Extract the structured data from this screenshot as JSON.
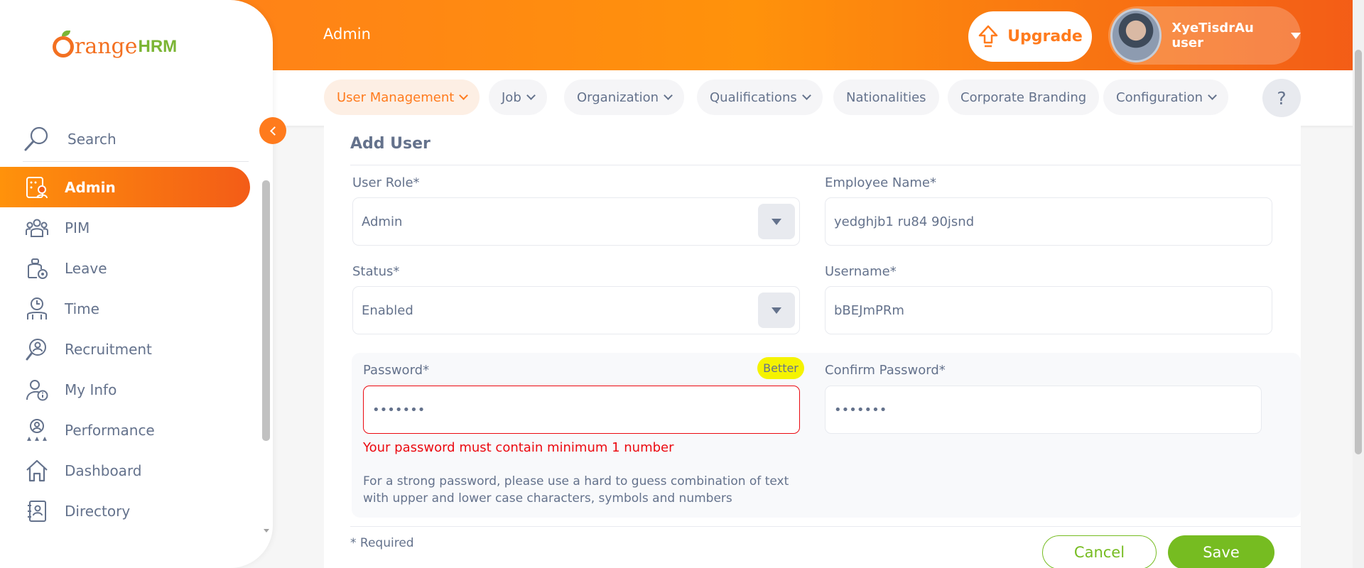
{
  "header": {
    "title": "Admin",
    "upgrade_label": "Upgrade",
    "user_name": "XyeTisdrAu user"
  },
  "tabs": [
    {
      "label": "User Management",
      "dropdown": true,
      "active": true
    },
    {
      "label": "Job",
      "dropdown": true
    },
    {
      "label": "Organization",
      "dropdown": true
    },
    {
      "label": "Qualifications",
      "dropdown": true
    },
    {
      "label": "Nationalities",
      "dropdown": false
    },
    {
      "label": "Corporate Branding",
      "dropdown": false
    },
    {
      "label": "Configuration",
      "dropdown": true
    }
  ],
  "help_label": "?",
  "sidebar": {
    "brand": {
      "text": "range",
      "suffix": "HRM"
    },
    "search_label": "Search",
    "items": [
      {
        "label": "Admin",
        "icon": "admin-icon",
        "active": true
      },
      {
        "label": "PIM",
        "icon": "pim-icon"
      },
      {
        "label": "Leave",
        "icon": "leave-icon"
      },
      {
        "label": "Time",
        "icon": "time-icon"
      },
      {
        "label": "Recruitment",
        "icon": "recruitment-icon"
      },
      {
        "label": "My Info",
        "icon": "my-info-icon"
      },
      {
        "label": "Performance",
        "icon": "performance-icon"
      },
      {
        "label": "Dashboard",
        "icon": "dashboard-icon"
      },
      {
        "label": "Directory",
        "icon": "directory-icon"
      }
    ]
  },
  "form": {
    "title": "Add User",
    "user_role": {
      "label": "User Role*",
      "value": "Admin"
    },
    "employee_name": {
      "label": "Employee Name*",
      "value": "yedghjb1 ru84 90jsnd"
    },
    "status": {
      "label": "Status*",
      "value": "Enabled"
    },
    "username": {
      "label": "Username*",
      "value": "bBEJmPRm"
    },
    "password": {
      "label": "Password*",
      "value": "•••••••",
      "strength": "Better",
      "error": "Your password must contain minimum 1 number"
    },
    "confirm_password": {
      "label": "Confirm Password*",
      "value": "•••••••"
    },
    "hint": "For a strong password, please use a hard to guess combination of text with upper and lower case characters, symbols and numbers",
    "required_note": "* Required",
    "cancel_label": "Cancel",
    "save_label": "Save"
  },
  "colors": {
    "accent": "#ff7b1d",
    "success": "#76bc21",
    "error": "#eb0910",
    "strength_badge": "#f5f300",
    "text": "#64728c"
  }
}
